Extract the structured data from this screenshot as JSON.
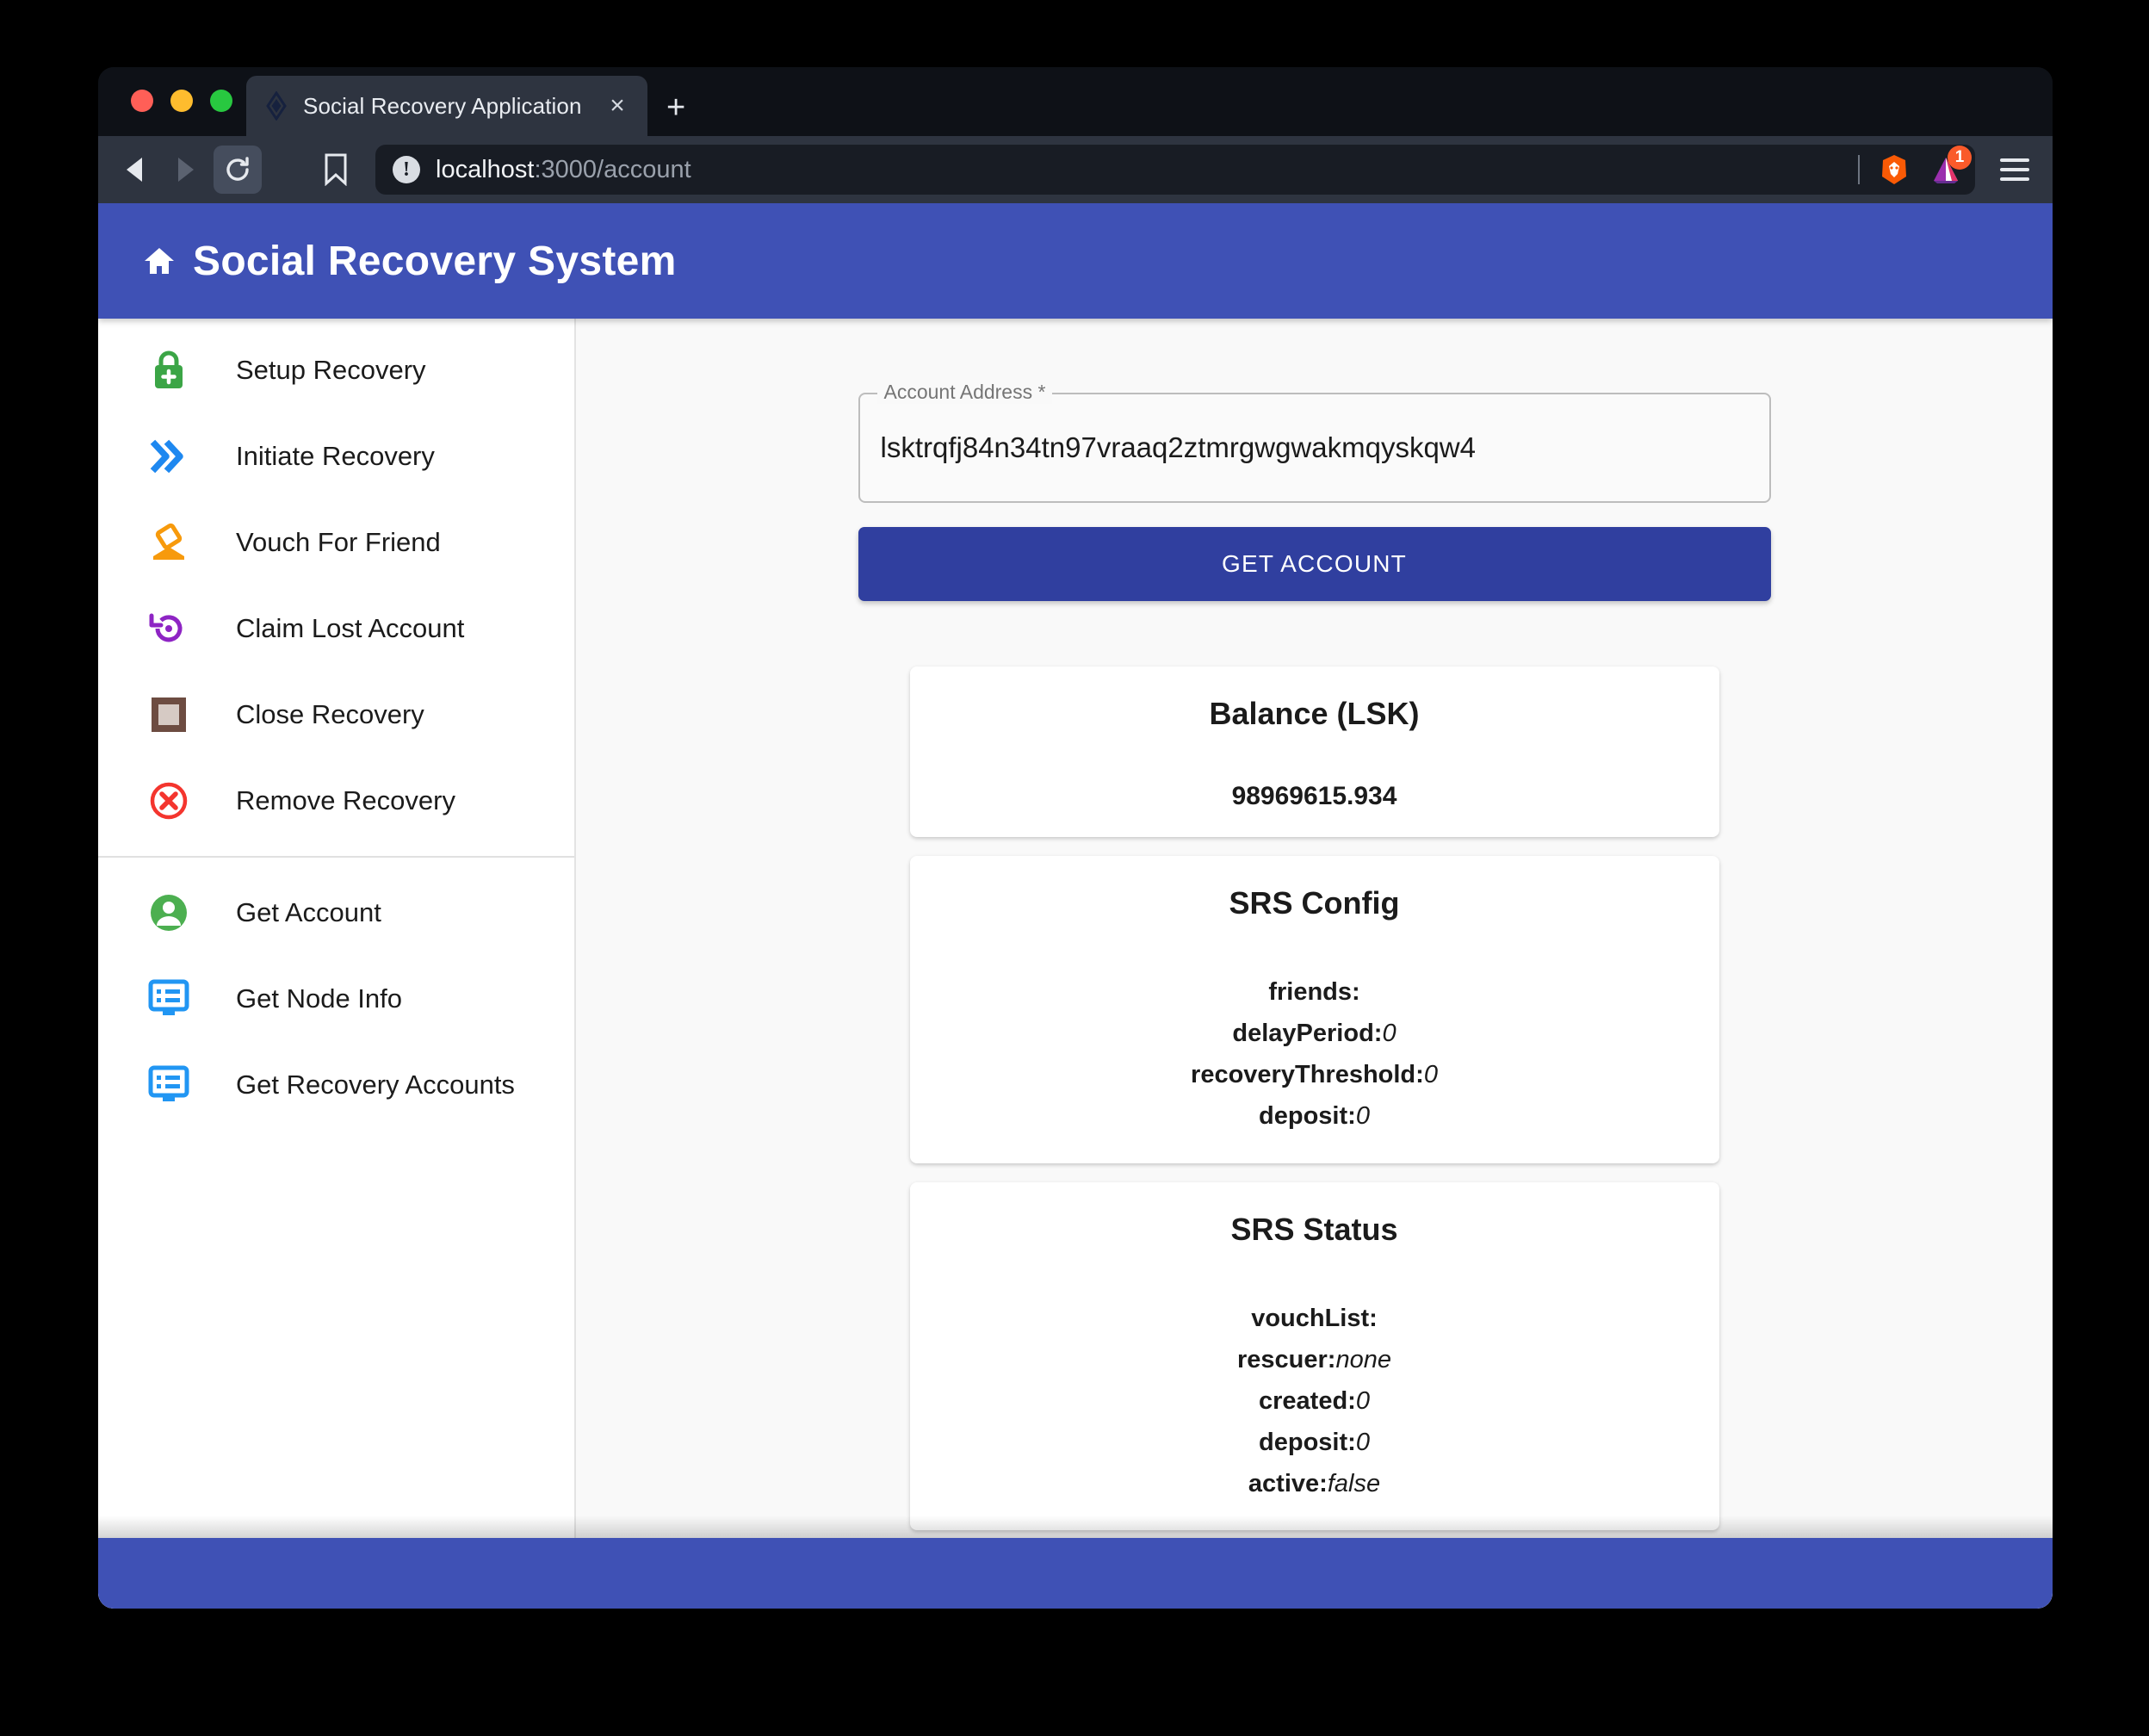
{
  "browser": {
    "tab": {
      "title": "Social Recovery Application",
      "favicon": "lisk-logo-icon",
      "close_label": "×"
    },
    "new_tab_label": "+",
    "toolbar": {
      "back_icon": "back-arrow-icon",
      "forward_icon": "forward-arrow-icon",
      "reload_icon": "reload-icon",
      "bookmark_icon": "bookmark-icon",
      "menu_icon": "hamburger-menu-icon"
    },
    "url": {
      "security_icon": "not-secure-info-icon",
      "host": "localhost",
      "path": ":3000/account"
    },
    "extensions": {
      "brave_shields_icon": "brave-lion-icon",
      "bat_rewards_icon": "bat-triangle-icon",
      "bat_badge_count": "1"
    }
  },
  "app": {
    "home_icon": "home-icon",
    "title": "Social Recovery System"
  },
  "sidebar": {
    "primary": [
      {
        "label": "Setup Recovery",
        "icon": "lock-plus-icon",
        "color": "#3ba546"
      },
      {
        "label": "Initiate Recovery",
        "icon": "double-chevron-right-icon",
        "color": "#1e88f0"
      },
      {
        "label": "Vouch For Friend",
        "icon": "approval-stamp-icon",
        "color": "#f79a0c"
      },
      {
        "label": "Claim Lost Account",
        "icon": "restore-circle-icon",
        "color": "#8e24c4"
      },
      {
        "label": "Close Recovery",
        "icon": "crop-square-icon",
        "color": "#6d4c41"
      },
      {
        "label": "Remove Recovery",
        "icon": "cancel-circle-icon",
        "color": "#f4352e"
      }
    ],
    "secondary": [
      {
        "label": "Get Account",
        "icon": "account-circle-icon",
        "color": "#4caf50"
      },
      {
        "label": "Get Node Info",
        "icon": "list-screen-icon",
        "color": "#2196f3"
      },
      {
        "label": "Get Recovery Accounts",
        "icon": "list-screen-icon",
        "color": "#2196f3"
      }
    ]
  },
  "form": {
    "address_label": "Account Address *",
    "address_value": "lsktrqfj84n34tn97vraaq2ztmrgwgwakmqyskqw4",
    "address_placeholder": "Account Address",
    "submit_label": "GET ACCOUNT"
  },
  "cards": {
    "balance": {
      "title": "Balance (LSK)",
      "value": "98969615.934"
    },
    "srs_config": {
      "title": "SRS Config",
      "rows": [
        {
          "key": "friends:",
          "value": ""
        },
        {
          "key": "delayPeriod:",
          "value": "0"
        },
        {
          "key": "recoveryThreshold:",
          "value": "0"
        },
        {
          "key": "deposit:",
          "value": "0"
        }
      ]
    },
    "srs_status": {
      "title": "SRS Status",
      "rows": [
        {
          "key": "vouchList:",
          "value": ""
        },
        {
          "key": "rescuer:",
          "value": "none"
        },
        {
          "key": "created:",
          "value": "0"
        },
        {
          "key": "deposit:",
          "value": "0"
        },
        {
          "key": "active:",
          "value": "false"
        }
      ]
    }
  },
  "theme": {
    "primary": "#3f51b5",
    "button": "#303f9f"
  }
}
